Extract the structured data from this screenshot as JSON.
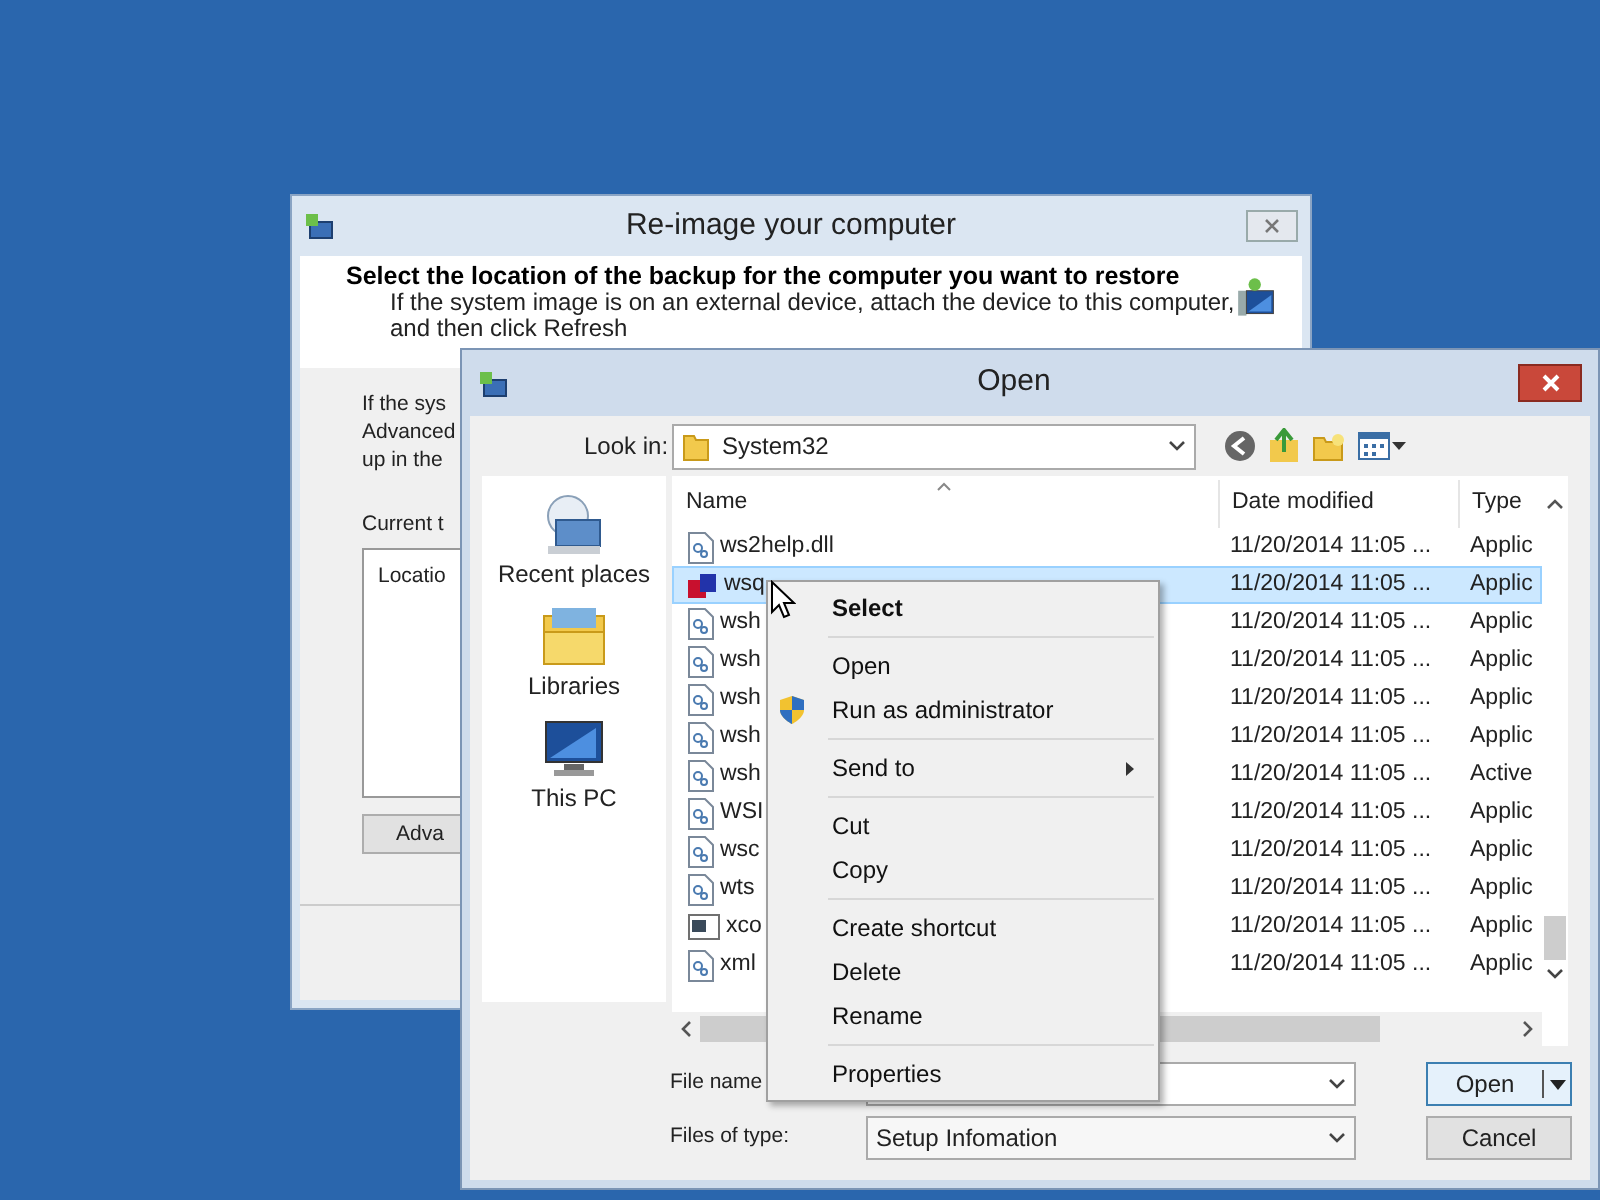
{
  "backup_window": {
    "title": "Re-image your computer",
    "heading": "Select the location of the backup for the computer you want to restore",
    "instruction": "If the system image is on an external device, attach the device to this computer,",
    "instruction_2": "and then click Refresh",
    "body_lines": [
      "If the sys",
      "Advanced",
      "up in the"
    ],
    "current_label": "Current t",
    "table": {
      "columns": [
        "Locatio"
      ]
    },
    "advanced_button": "Adva"
  },
  "open_dialog": {
    "title": "Open",
    "look_in_label": "Look in:",
    "look_in_value": "System32",
    "places": [
      {
        "label": "Recent places",
        "kind": "recent"
      },
      {
        "label": "Libraries",
        "kind": "libraries"
      },
      {
        "label": "This PC",
        "kind": "pc"
      }
    ],
    "columns": [
      "Name",
      "Date modified",
      "Type"
    ],
    "rows": [
      {
        "name": "ws2help.dll",
        "date": "11/20/2014 11:05 ...",
        "type": "Applic",
        "kind": "doc",
        "selected": false
      },
      {
        "name": "wsq",
        "date": "11/20/2014 11:05 ...",
        "type": "Applic",
        "kind": "app",
        "selected": true
      },
      {
        "name": "wsh",
        "date": "11/20/2014 11:05 ...",
        "type": "Applic",
        "kind": "doc",
        "selected": false
      },
      {
        "name": "wsh",
        "date": "11/20/2014 11:05 ...",
        "type": "Applic",
        "kind": "doc",
        "selected": false
      },
      {
        "name": "wsh",
        "date": "11/20/2014 11:05 ...",
        "type": "Applic",
        "kind": "doc",
        "selected": false
      },
      {
        "name": "wsh",
        "date": "11/20/2014 11:05 ...",
        "type": "Applic",
        "kind": "doc",
        "selected": false
      },
      {
        "name": "wsh",
        "date": "11/20/2014 11:05 ...",
        "type": "Active",
        "kind": "doc",
        "selected": false
      },
      {
        "name": "WSI",
        "date": "11/20/2014 11:05 ...",
        "type": "Applic",
        "kind": "doc",
        "selected": false
      },
      {
        "name": "wsc",
        "date": "11/20/2014 11:05 ...",
        "type": "Applic",
        "kind": "doc",
        "selected": false
      },
      {
        "name": "wts",
        "date": "11/20/2014 11:05 ...",
        "type": "Applic",
        "kind": "doc",
        "selected": false
      },
      {
        "name": "xco",
        "date": "11/20/2014 11:05 ...",
        "type": "Applic",
        "kind": "console",
        "selected": false
      },
      {
        "name": "xml",
        "date": "11/20/2014 11:05 ...",
        "type": "Applic",
        "kind": "doc",
        "selected": false
      }
    ],
    "file_name_label": "File name",
    "files_of_type_label": "Files of type:",
    "files_of_type_value": "Setup Infomation",
    "open_button": "Open",
    "cancel_button": "Cancel"
  },
  "context_menu": {
    "groups": [
      [
        {
          "label": "Select",
          "kind": "default"
        }
      ],
      [
        {
          "label": "Open",
          "kind": "plain"
        },
        {
          "label": "Run as administrator",
          "kind": "elevated"
        }
      ],
      [
        {
          "label": "Send to",
          "kind": "submenu"
        }
      ],
      [
        {
          "label": "Cut",
          "kind": "plain"
        },
        {
          "label": "Copy",
          "kind": "plain"
        }
      ],
      [
        {
          "label": "Create shortcut",
          "kind": "plain"
        },
        {
          "label": "Delete",
          "kind": "plain"
        },
        {
          "label": "Rename",
          "kind": "plain"
        }
      ],
      [
        {
          "label": "Properties",
          "kind": "plain"
        }
      ]
    ]
  }
}
